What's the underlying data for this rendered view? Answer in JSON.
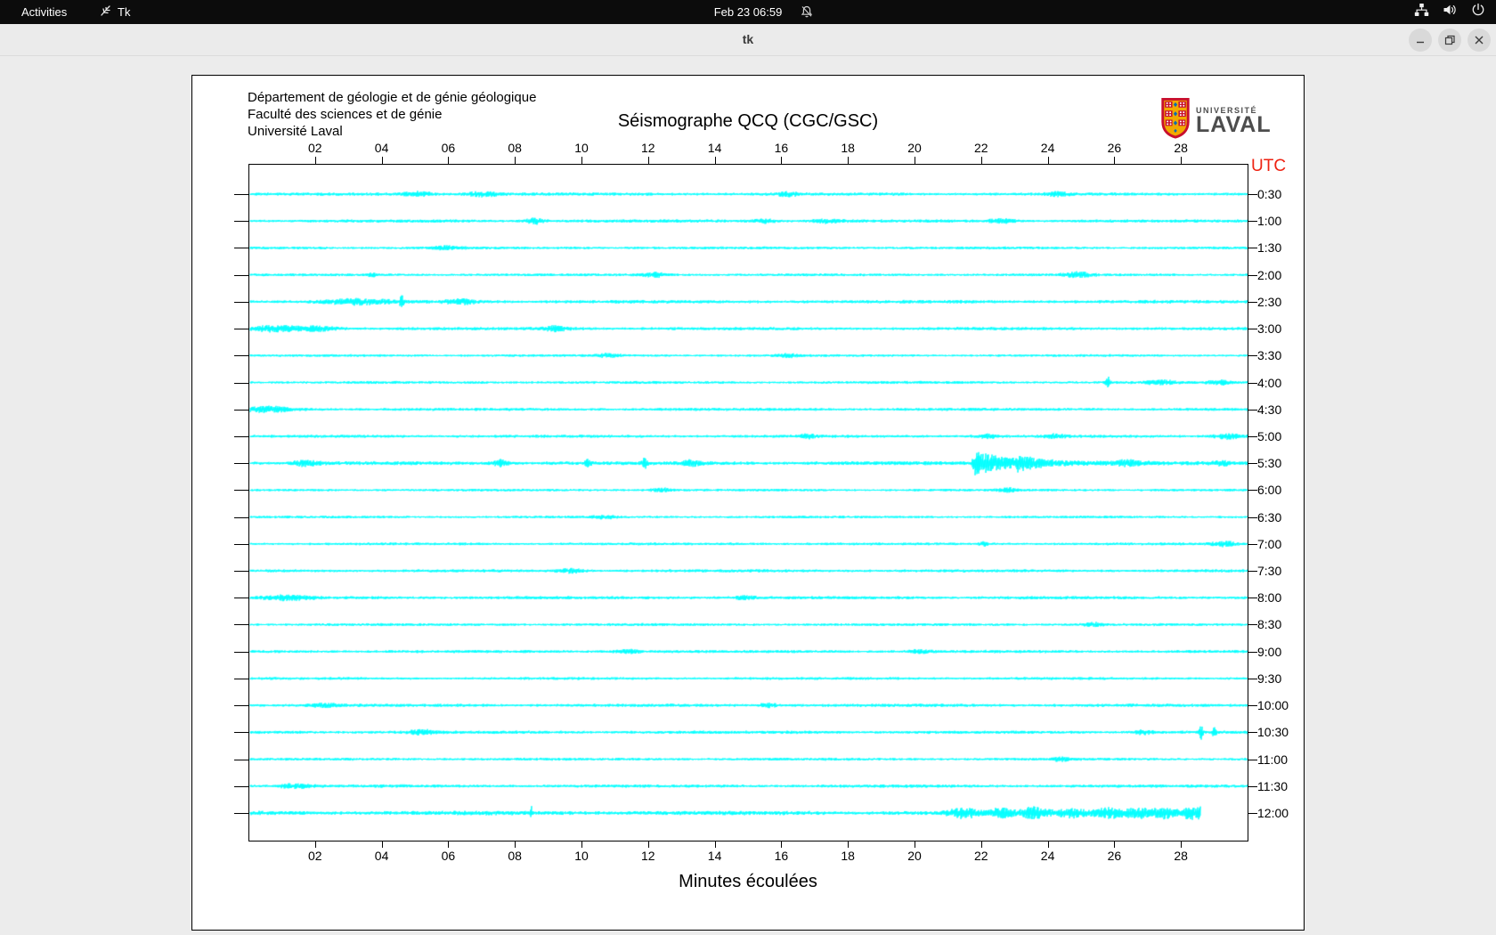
{
  "topbar": {
    "activities_label": "Activities",
    "app_menu_label": "Tk",
    "clock": "Feb 23 06:59"
  },
  "titlebar": {
    "title": "tk",
    "buttons": [
      "minimize",
      "restore",
      "close"
    ]
  },
  "sheet": {
    "institution_lines": [
      "Département de géologie et de génie géologique",
      "Faculté des sciences et de génie",
      "Université Laval"
    ],
    "title": "Séismographe QCQ (CGC/GSC)",
    "logo": {
      "line_small": "UNIVERSITÉ",
      "line_large": "LAVAL"
    },
    "utc_label": "UTC",
    "xlabel": "Minutes écoulées"
  },
  "chart_data": {
    "type": "line",
    "subtype": "helicorder-seismogram",
    "title": "Séismographe QCQ (CGC/GSC)",
    "xlabel": "Minutes écoulées",
    "right_axis_title": "UTC",
    "x_range": [
      0,
      30
    ],
    "minutes_per_row": 30,
    "row_count": 24,
    "grid": false,
    "x_tick_minutes": [
      2,
      4,
      6,
      8,
      10,
      12,
      14,
      16,
      18,
      20,
      22,
      24,
      26,
      28
    ],
    "x_tick_labels": [
      "02",
      "04",
      "06",
      "08",
      "10",
      "12",
      "14",
      "16",
      "18",
      "20",
      "22",
      "24",
      "26",
      "28"
    ],
    "colors": {
      "trace": "#00ffff",
      "axis": "#000000",
      "utc_label": "#ee2211"
    },
    "traces": [
      {
        "utc": "0:30",
        "base_amp": 1.5,
        "events": [
          {
            "t": 5.1,
            "amp": 2.5,
            "w": 0.3
          },
          {
            "t": 7.0,
            "amp": 2.5,
            "w": 0.35
          },
          {
            "t": 16.2,
            "amp": 2.0,
            "w": 0.2
          },
          {
            "t": 24.3,
            "amp": 2.0,
            "w": 0.25
          }
        ]
      },
      {
        "utc": "1:00",
        "base_amp": 1.5,
        "events": [
          {
            "t": 8.6,
            "amp": 3.0,
            "w": 0.18
          },
          {
            "t": 15.5,
            "amp": 2.2,
            "w": 0.2
          },
          {
            "t": 17.4,
            "amp": 1.8,
            "w": 0.3
          },
          {
            "t": 22.6,
            "amp": 2.2,
            "w": 0.25
          }
        ]
      },
      {
        "utc": "1:30",
        "base_amp": 1.3,
        "events": [
          {
            "t": 5.9,
            "amp": 1.8,
            "w": 0.3
          }
        ]
      },
      {
        "utc": "2:00",
        "base_amp": 1.3,
        "events": [
          {
            "t": 3.7,
            "amp": 2.5,
            "w": 0.08
          },
          {
            "t": 12.2,
            "amp": 2.2,
            "w": 0.25
          },
          {
            "t": 24.9,
            "amp": 2.5,
            "w": 0.3
          }
        ]
      },
      {
        "utc": "2:30",
        "base_amp": 1.6,
        "events": [
          {
            "t": 3.2,
            "amp": 2.6,
            "w": 0.7
          },
          {
            "t": 4.6,
            "amp": 12,
            "w": 0.03
          },
          {
            "t": 6.4,
            "amp": 2.5,
            "w": 0.3
          }
        ]
      },
      {
        "utc": "3:00",
        "base_amp": 1.5,
        "events": [
          {
            "t": 0.8,
            "amp": 2.6,
            "w": 0.6
          },
          {
            "t": 2.2,
            "amp": 2.2,
            "w": 0.4
          },
          {
            "t": 9.2,
            "amp": 2.4,
            "w": 0.3
          }
        ]
      },
      {
        "utc": "3:30",
        "base_amp": 1.2,
        "events": [
          {
            "t": 10.8,
            "amp": 1.8,
            "w": 0.25
          },
          {
            "t": 16.2,
            "amp": 1.8,
            "w": 0.2
          }
        ]
      },
      {
        "utc": "4:00",
        "base_amp": 1.3,
        "events": [
          {
            "t": 25.8,
            "amp": 9,
            "w": 0.04
          },
          {
            "t": 27.4,
            "amp": 2.2,
            "w": 0.3
          },
          {
            "t": 29.2,
            "amp": 2.4,
            "w": 0.25
          }
        ]
      },
      {
        "utc": "4:30",
        "base_amp": 1.4,
        "events": [
          {
            "t": 0.6,
            "amp": 3.0,
            "w": 0.45
          }
        ]
      },
      {
        "utc": "5:00",
        "base_amp": 1.4,
        "events": [
          {
            "t": 16.8,
            "amp": 2.2,
            "w": 0.15
          },
          {
            "t": 22.2,
            "amp": 2.4,
            "w": 0.2
          },
          {
            "t": 24.2,
            "amp": 2.0,
            "w": 0.2
          },
          {
            "t": 29.4,
            "amp": 2.6,
            "w": 0.3
          }
        ]
      },
      {
        "utc": "5:30",
        "base_amp": 1.8,
        "events": [
          {
            "t": 1.7,
            "amp": 2.5,
            "w": 0.3
          },
          {
            "t": 7.6,
            "amp": 3.0,
            "w": 0.15
          },
          {
            "t": 10.2,
            "amp": 4.0,
            "w": 0.06
          },
          {
            "t": 11.9,
            "amp": 5.0,
            "w": 0.06
          },
          {
            "t": 13.3,
            "amp": 2.5,
            "w": 0.2
          },
          {
            "t": 21.8,
            "amp": 13,
            "decay": 1.1
          },
          {
            "t": 23.1,
            "amp": 5,
            "decay": 0.7
          },
          {
            "t": 26.4,
            "amp": 2.5,
            "w": 0.3
          },
          {
            "t": 29.2,
            "amp": 2.5,
            "w": 0.2
          }
        ]
      },
      {
        "utc": "6:00",
        "base_amp": 1.2,
        "events": [
          {
            "t": 12.4,
            "amp": 1.8,
            "w": 0.2
          },
          {
            "t": 22.8,
            "amp": 1.8,
            "w": 0.2
          }
        ]
      },
      {
        "utc": "6:30",
        "base_amp": 1.2,
        "events": [
          {
            "t": 10.7,
            "amp": 1.6,
            "w": 0.25
          }
        ]
      },
      {
        "utc": "7:00",
        "base_amp": 1.3,
        "events": [
          {
            "t": 22.1,
            "amp": 2.5,
            "w": 0.08
          },
          {
            "t": 29.3,
            "amp": 2.4,
            "w": 0.25
          }
        ]
      },
      {
        "utc": "7:30",
        "base_amp": 1.4,
        "events": [
          {
            "t": 9.7,
            "amp": 1.8,
            "w": 0.3
          }
        ]
      },
      {
        "utc": "8:00",
        "base_amp": 1.5,
        "events": [
          {
            "t": 1.2,
            "amp": 2.2,
            "w": 0.5
          },
          {
            "t": 14.9,
            "amp": 1.8,
            "w": 0.2
          }
        ]
      },
      {
        "utc": "8:30",
        "base_amp": 1.3,
        "events": [
          {
            "t": 25.4,
            "amp": 1.8,
            "w": 0.2
          }
        ]
      },
      {
        "utc": "9:00",
        "base_amp": 1.4,
        "events": [
          {
            "t": 11.4,
            "amp": 1.8,
            "w": 0.25
          },
          {
            "t": 20.2,
            "amp": 1.8,
            "w": 0.2
          }
        ]
      },
      {
        "utc": "9:30",
        "base_amp": 1.3,
        "events": []
      },
      {
        "utc": "10:00",
        "base_amp": 1.5,
        "events": [
          {
            "t": 2.3,
            "amp": 2.0,
            "w": 0.3
          },
          {
            "t": 15.6,
            "amp": 1.8,
            "w": 0.2
          }
        ]
      },
      {
        "utc": "10:30",
        "base_amp": 1.5,
        "events": [
          {
            "t": 5.2,
            "amp": 2.2,
            "w": 0.3
          },
          {
            "t": 26.9,
            "amp": 2.0,
            "w": 0.2
          },
          {
            "t": 28.6,
            "amp": 7,
            "w": 0.04
          },
          {
            "t": 29.0,
            "amp": 5,
            "w": 0.04
          }
        ]
      },
      {
        "utc": "11:00",
        "base_amp": 1.3,
        "events": [
          {
            "t": 24.4,
            "amp": 1.8,
            "w": 0.2
          }
        ]
      },
      {
        "utc": "11:30",
        "base_amp": 1.5,
        "events": [
          {
            "t": 1.4,
            "amp": 2.0,
            "w": 0.35
          }
        ]
      },
      {
        "utc": "12:00",
        "base_amp": 2.0,
        "end_min": 28.6,
        "events": [
          {
            "t": 8.5,
            "amp": 6,
            "w": 0.03
          },
          {
            "t": 21.5,
            "amp": 5,
            "w": 0.3
          },
          {
            "t": 22.6,
            "amp": 4,
            "w": 0.25
          },
          {
            "t": 23.6,
            "amp": 5.5,
            "w": 0.3
          },
          {
            "t": 24.7,
            "amp": 4.5,
            "w": 0.3
          },
          {
            "t": 25.8,
            "amp": 5.5,
            "w": 0.35
          },
          {
            "t": 26.7,
            "amp": 4.5,
            "w": 0.3
          },
          {
            "t": 27.5,
            "amp": 5,
            "w": 0.3
          },
          {
            "t": 28.3,
            "amp": 6,
            "w": 0.15
          },
          {
            "t": 28.55,
            "amp": 9,
            "w": 0.03
          }
        ]
      }
    ]
  }
}
